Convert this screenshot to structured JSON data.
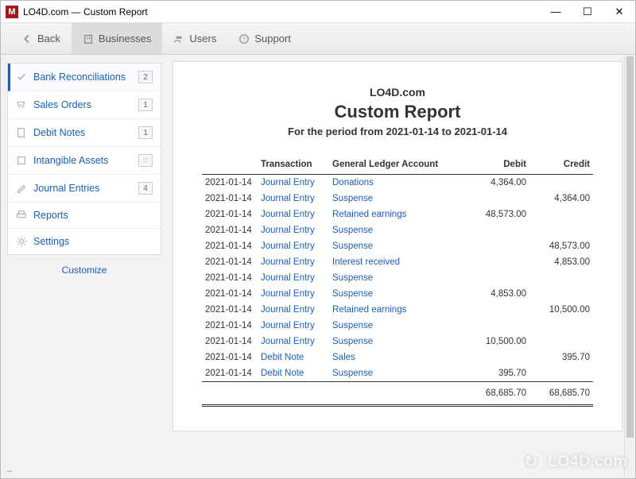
{
  "window": {
    "app_letter": "M",
    "title": "LO4D.com — Custom Report",
    "min": "—",
    "max": "☐",
    "close": "✕"
  },
  "toolbar": {
    "back": "Back",
    "businesses": "Businesses",
    "users": "Users",
    "support": "Support"
  },
  "sidebar": {
    "items": [
      {
        "label": "Bank Reconciliations",
        "badge": "2"
      },
      {
        "label": "Sales Orders",
        "badge": "1"
      },
      {
        "label": "Debit Notes",
        "badge": "1"
      },
      {
        "label": "Intangible Assets",
        "badge": "0"
      },
      {
        "label": "Journal Entries",
        "badge": "4"
      },
      {
        "label": "Reports",
        "badge": ""
      },
      {
        "label": "Settings",
        "badge": ""
      }
    ],
    "customize": "Customize"
  },
  "report": {
    "org": "LO4D.com",
    "title": "Custom Report",
    "period": "For the period from 2021-01-14 to 2021-01-14",
    "columns": {
      "date": "",
      "transaction": "Transaction",
      "account": "General Ledger Account",
      "debit": "Debit",
      "credit": "Credit"
    },
    "rows": [
      {
        "date": "2021-01-14",
        "txn": "Journal Entry",
        "acct": "Donations",
        "debit": "4,364.00",
        "credit": ""
      },
      {
        "date": "2021-01-14",
        "txn": "Journal Entry",
        "acct": "Suspense",
        "debit": "",
        "credit": "4,364.00"
      },
      {
        "date": "2021-01-14",
        "txn": "Journal Entry",
        "acct": "Retained earnings",
        "debit": "48,573.00",
        "credit": ""
      },
      {
        "date": "2021-01-14",
        "txn": "Journal Entry",
        "acct": "Suspense",
        "debit": "",
        "credit": ""
      },
      {
        "date": "2021-01-14",
        "txn": "Journal Entry",
        "acct": "Suspense",
        "debit": "",
        "credit": "48,573.00"
      },
      {
        "date": "2021-01-14",
        "txn": "Journal Entry",
        "acct": "Interest received",
        "debit": "",
        "credit": "4,853.00"
      },
      {
        "date": "2021-01-14",
        "txn": "Journal Entry",
        "acct": "Suspense",
        "debit": "",
        "credit": ""
      },
      {
        "date": "2021-01-14",
        "txn": "Journal Entry",
        "acct": "Suspense",
        "debit": "4,853.00",
        "credit": ""
      },
      {
        "date": "2021-01-14",
        "txn": "Journal Entry",
        "acct": "Retained earnings",
        "debit": "",
        "credit": "10,500.00"
      },
      {
        "date": "2021-01-14",
        "txn": "Journal Entry",
        "acct": "Suspense",
        "debit": "",
        "credit": ""
      },
      {
        "date": "2021-01-14",
        "txn": "Journal Entry",
        "acct": "Suspense",
        "debit": "10,500.00",
        "credit": ""
      },
      {
        "date": "2021-01-14",
        "txn": "Debit Note",
        "acct": "Sales",
        "debit": "",
        "credit": "395.70"
      },
      {
        "date": "2021-01-14",
        "txn": "Debit Note",
        "acct": "Suspense",
        "debit": "395.70",
        "credit": ""
      }
    ],
    "totals": {
      "debit": "68,685.70",
      "credit": "68,685.70"
    }
  },
  "watermark": {
    "text": "LO4D.com",
    "glyph": "↻"
  },
  "status": {
    "link": "↔"
  }
}
